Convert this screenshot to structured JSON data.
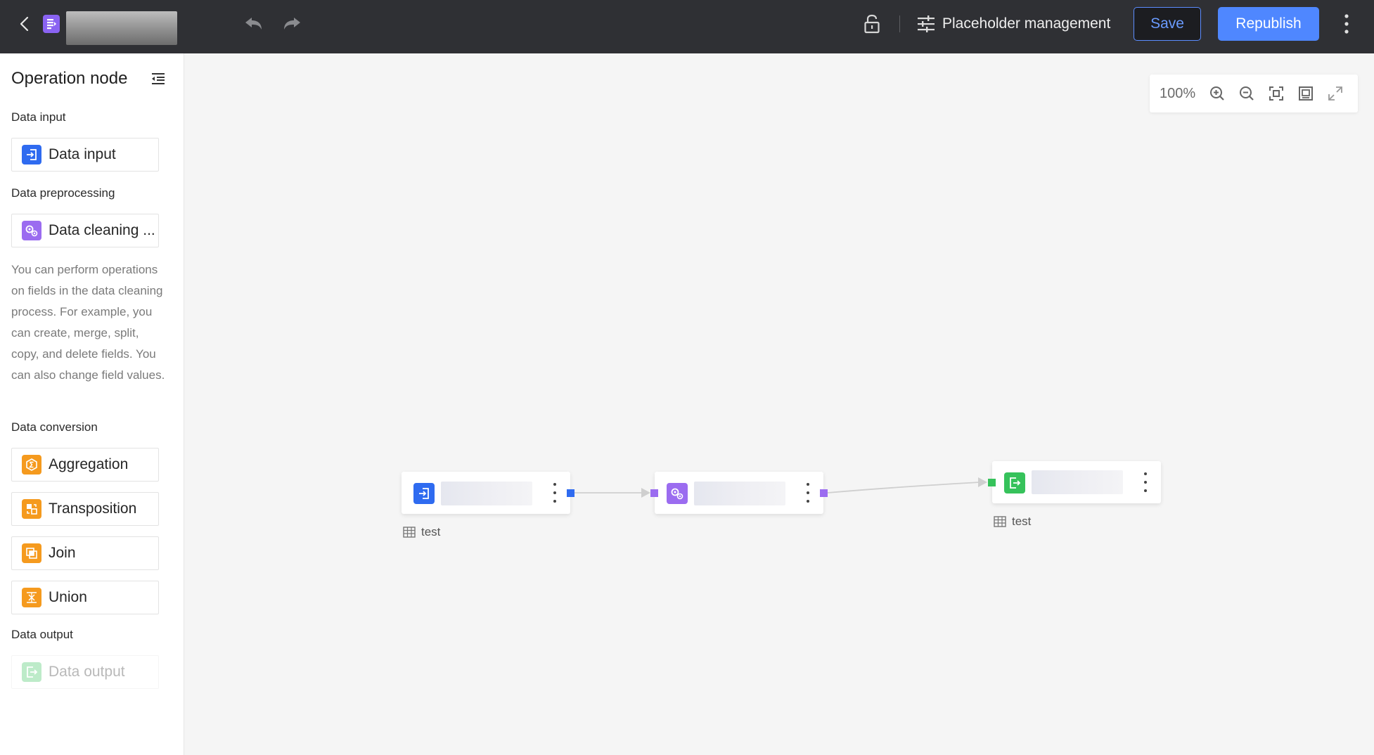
{
  "header": {
    "placeholder_label": "Placeholder management",
    "save_label": "Save",
    "republish_label": "Republish"
  },
  "sidebar": {
    "title": "Operation node",
    "sections": {
      "data_input": {
        "label": "Data input",
        "items": [
          {
            "label": "Data input",
            "icon": "data-input-icon",
            "color": "#2f6bf0"
          }
        ]
      },
      "data_preprocessing": {
        "label": "Data preprocessing",
        "items": [
          {
            "label": "Data cleaning ...",
            "icon": "data-cleaning-icon",
            "color": "#9b6cf0"
          }
        ],
        "description": "You can perform operations on fields in the data cleaning process. For example, you can create, merge, split, copy, and delete fields. You can also change field values."
      },
      "data_conversion": {
        "label": "Data conversion",
        "items": [
          {
            "label": "Aggregation",
            "icon": "aggregation-icon",
            "color": "#f59a1e"
          },
          {
            "label": "Transposition",
            "icon": "transposition-icon",
            "color": "#f59a1e"
          },
          {
            "label": "Join",
            "icon": "join-icon",
            "color": "#f59a1e"
          },
          {
            "label": "Union",
            "icon": "union-icon",
            "color": "#f59a1e"
          }
        ]
      },
      "data_output": {
        "label": "Data output",
        "items": [
          {
            "label": "Data output",
            "icon": "data-output-icon",
            "color": "#36c25b",
            "disabled": true
          }
        ]
      }
    }
  },
  "canvas": {
    "zoom": "100%",
    "nodes": [
      {
        "type": "data-input",
        "icon": "data-input-icon",
        "color": "#2f6bf0",
        "table": "test"
      },
      {
        "type": "data-cleaning",
        "icon": "data-cleaning-icon",
        "color": "#9b6cf0"
      },
      {
        "type": "data-output",
        "icon": "data-output-icon",
        "color": "#36c25b",
        "table": "test"
      }
    ]
  }
}
